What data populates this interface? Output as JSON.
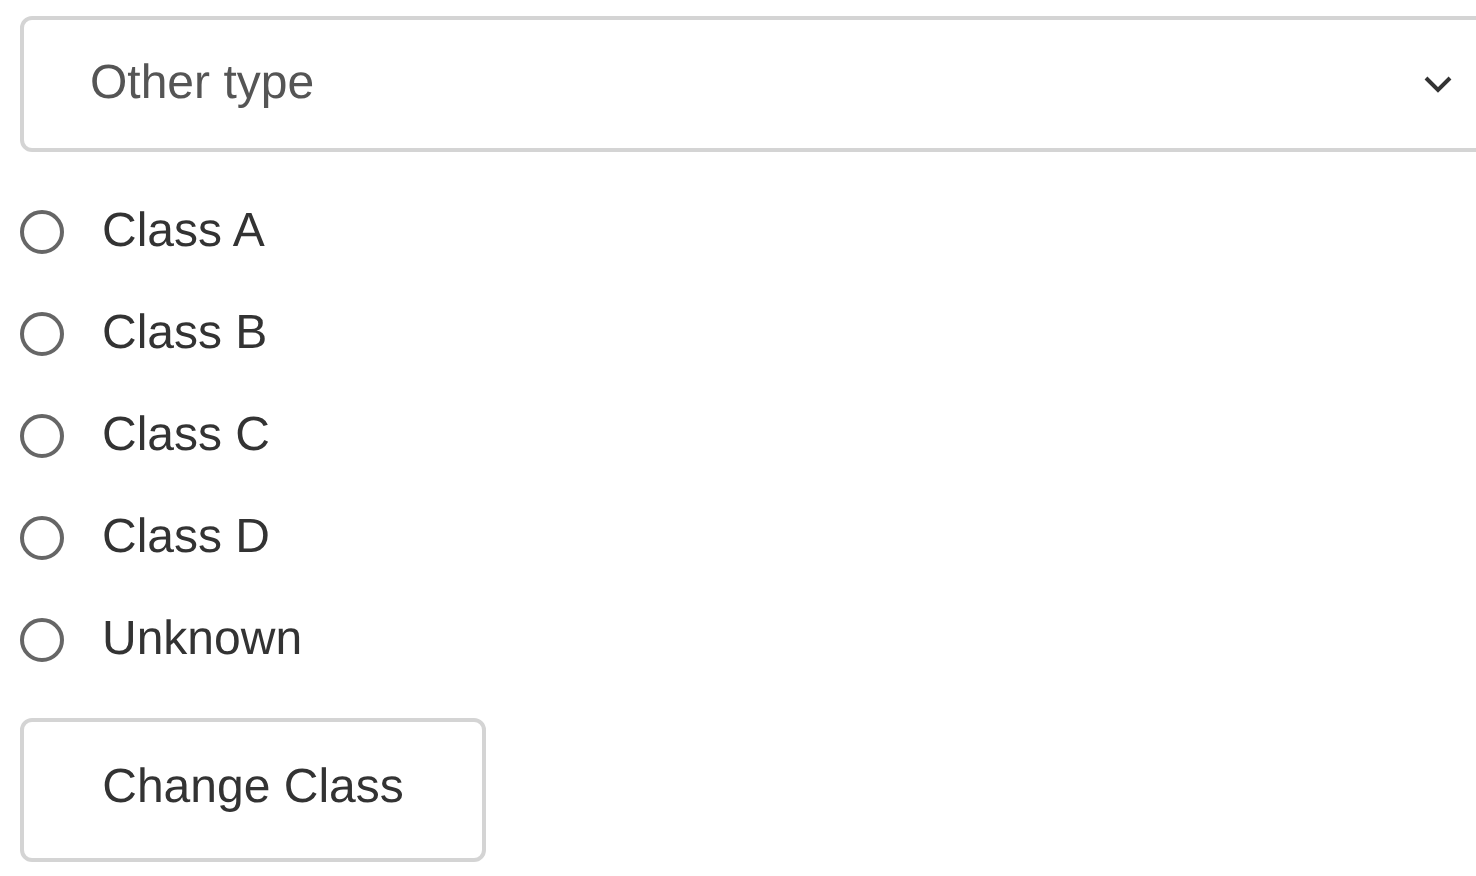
{
  "type_select": {
    "value": "Other type"
  },
  "classes": [
    {
      "label": "Class A",
      "selected": false
    },
    {
      "label": "Class B",
      "selected": false
    },
    {
      "label": "Class C",
      "selected": false
    },
    {
      "label": "Class D",
      "selected": false
    },
    {
      "label": "Unknown",
      "selected": false
    }
  ],
  "button": {
    "label": "Change Class"
  }
}
